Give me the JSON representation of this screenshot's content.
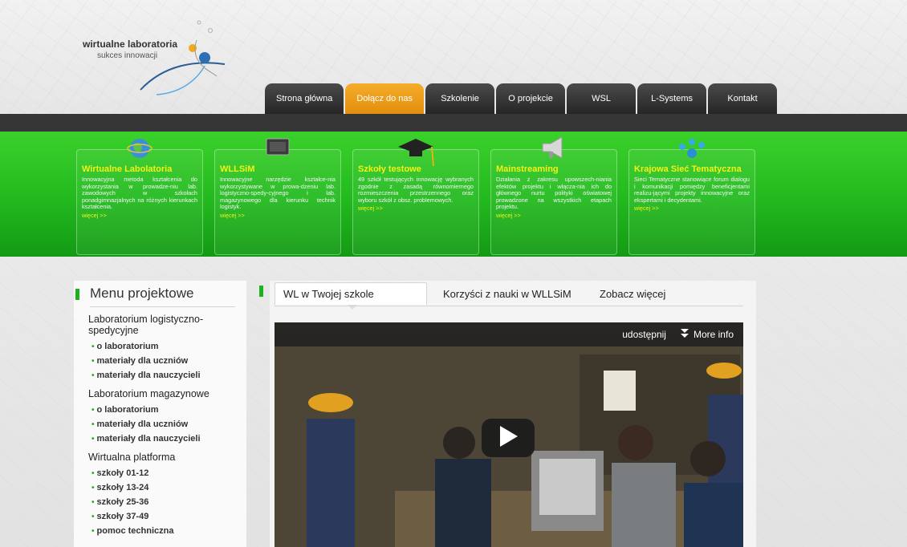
{
  "logo": {
    "title": "wirtualne laboratoria",
    "subtitle": "sukces innowacji"
  },
  "nav": {
    "tabs": [
      {
        "label": "Strona główna"
      },
      {
        "label": "Dołącz do nas"
      },
      {
        "label": "Szkolenie"
      },
      {
        "label": "O projekcie"
      },
      {
        "label": "WSL"
      },
      {
        "label": "L-Systems"
      },
      {
        "label": "Kontakt"
      }
    ],
    "active_index": 1
  },
  "features": [
    {
      "icon": "globe-icon",
      "title": "Wirtualne Labolatoria",
      "text": "Innowacyjna metoda kształcenia do wykorzystania w prowadze-niu lab. zawodowych w szkołach ponadgimnazjalnych na różnych kierunkach kształcenia.",
      "more": "więcej >>"
    },
    {
      "icon": "chip-icon",
      "title": "WLLSiM",
      "text": "Innowacyjne narzędzie kształce-nia wykorzystywane w prowa-dzeniu lab. logistyczno-spedy-cyjnego i lab. magazynowego dla kierunku technik logistyk.",
      "more": "więcej >>"
    },
    {
      "icon": "graduation-cap-icon",
      "title": "Szkoły testowe",
      "text": "49 szkół testujących innowację wybranych zgodnie z zasadą równomiernego rozmieszczenia przestrzennego oraz wyboru szkół z obsz. problemowych.",
      "more": "więcej >>"
    },
    {
      "icon": "megaphone-icon",
      "title": "Mainstreaming",
      "text": "Działania z zakresu upowszech-niania efektów projektu i włącza-nia ich do głównego nurtu polityki oświatowej prowadzone na wszystkich etapach projektu.",
      "more": "więcej >>"
    },
    {
      "icon": "network-icon",
      "title": "Krajowa Sieć Tematyczna",
      "text": "Sieci Tematyczne stanowiące forum dialogu i komunikacji pomiędzy beneficjentami realizu-jącymi projekty innowacyjne oraz ekspertami i decydentami.",
      "more": "więcej >>"
    }
  ],
  "sidebar": {
    "title": "Menu projektowe",
    "groups": [
      {
        "label": "Laboratorium logistyczno-spedycyjne",
        "links": [
          "o laboratorium",
          "materiały dla uczniów",
          "materiały dla nauczycieli"
        ]
      },
      {
        "label": "Laboratorium magazynowe",
        "links": [
          "o laboratorium",
          "materiały dla uczniów",
          "materiały dla nauczycieli"
        ]
      },
      {
        "label": "Wirtualna platforma",
        "links": [
          "szkoły 01-12",
          "szkoły 13-24",
          "szkoły 25-36",
          "szkoły 37-49",
          "pomoc techniczna"
        ]
      }
    ]
  },
  "main": {
    "tabs": [
      {
        "label": "WL w Twojej szkole"
      },
      {
        "label": "Korzyści z nauki w WLLSiM"
      },
      {
        "label": "Zobacz więcej"
      }
    ],
    "video": {
      "share_label": "udostępnij",
      "info_label": "More info"
    }
  },
  "colors": {
    "green": "#22b91e",
    "orange": "#f0a020",
    "dark": "#333333",
    "yellow": "#f2f21a"
  }
}
